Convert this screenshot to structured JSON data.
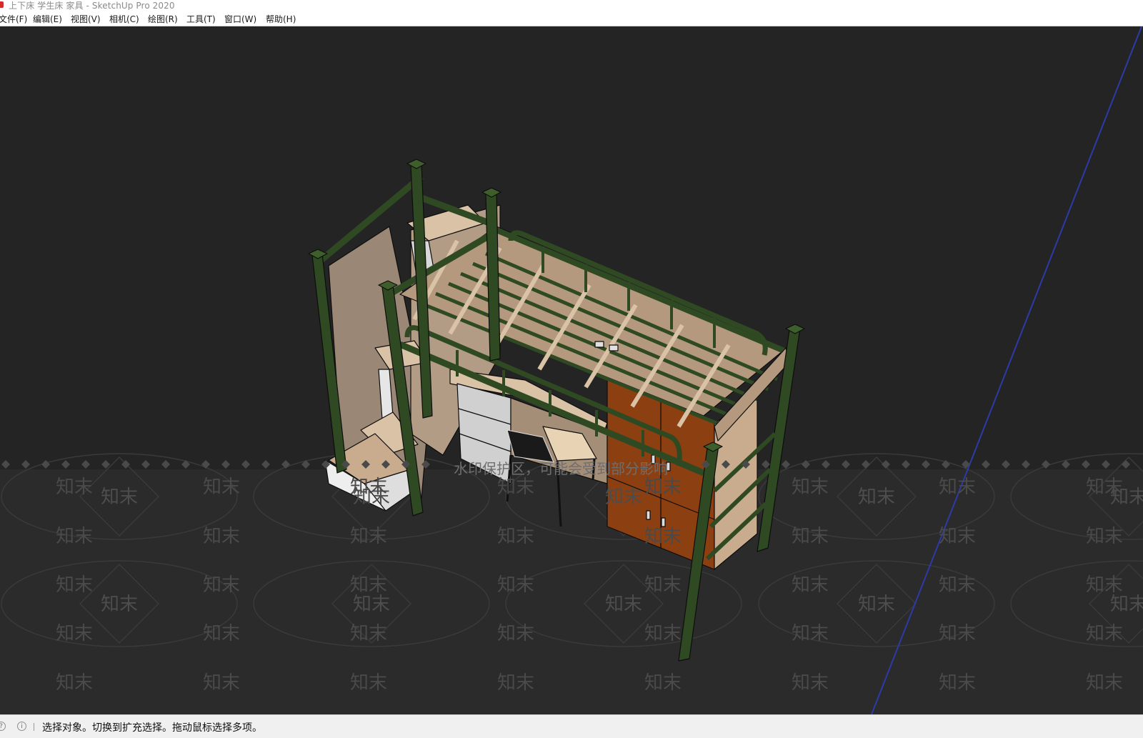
{
  "window": {
    "title": "上下床 学生床 家具 - SketchUp Pro 2020"
  },
  "menu": {
    "items": [
      "文件(F)",
      "编辑(E)",
      "视图(V)",
      "相机(C)",
      "绘图(R)",
      "工具(T)",
      "窗口(W)",
      "帮助(H)"
    ]
  },
  "watermark": {
    "notice": "水印保护区，可能会受到部分影响",
    "brand": "知末"
  },
  "status": {
    "message": "选择对象。切换到扩充选择。拖动鼠标选择多项。"
  },
  "colors": {
    "viewport_bg": "#242424",
    "frame_green": "#2f4a22",
    "wood": "#c8ad8f",
    "wardrobe": "#8c3f10",
    "axis_blue": "#2e3aa8"
  }
}
